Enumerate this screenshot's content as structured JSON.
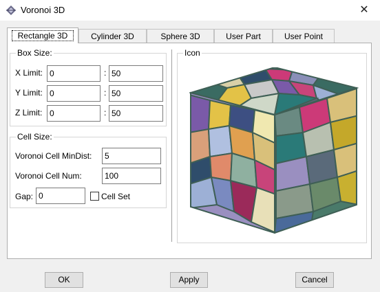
{
  "window": {
    "title": "Voronoi 3D",
    "close_glyph": "✕"
  },
  "tabs": [
    {
      "label": "Rectangle 3D",
      "active": true
    },
    {
      "label": "Cylinder 3D",
      "active": false
    },
    {
      "label": "Sphere 3D",
      "active": false
    },
    {
      "label": "User Part",
      "active": false
    },
    {
      "label": "User Point",
      "active": false
    }
  ],
  "box_size": {
    "legend": "Box Size:",
    "separator": ":",
    "x": {
      "label": "X Limit:",
      "min": "0",
      "max": "50"
    },
    "y": {
      "label": "Y Limit:",
      "min": "0",
      "max": "50"
    },
    "z": {
      "label": "Z Limit:",
      "min": "0",
      "max": "50"
    }
  },
  "cell_size": {
    "legend": "Cell Size:",
    "min_dist": {
      "label": "Voronoi Cell MinDist:",
      "value": "5"
    },
    "num": {
      "label": "Voronoi Cell Num:",
      "value": "100"
    },
    "gap": {
      "label": "Gap:",
      "value": "0"
    },
    "cell_set": {
      "label": "Cell Set",
      "checked": false
    }
  },
  "icon_group": {
    "legend": "Icon"
  },
  "buttons": {
    "ok": "OK",
    "apply": "Apply",
    "cancel": "Cancel"
  },
  "icons": {
    "app": "voronoi-app-icon",
    "preview": "voronoi-cube-icon",
    "close": "close-icon"
  }
}
